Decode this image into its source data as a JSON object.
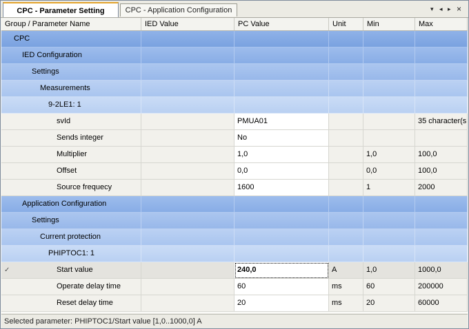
{
  "tabs": [
    {
      "label": "CPC - Parameter Setting",
      "active": true
    },
    {
      "label": "CPC - Application Configuration",
      "active": false
    }
  ],
  "tab_controls": {
    "dropdown": "▾",
    "prev": "◂",
    "next": "▸",
    "close": "×"
  },
  "columns": [
    "Group / Parameter Name",
    "IED Value",
    "PC Value",
    "Unit",
    "Min",
    "Max"
  ],
  "rows": [
    {
      "level": 0,
      "type": "group",
      "name": "CPC"
    },
    {
      "level": 1,
      "type": "group",
      "name": "IED Configuration"
    },
    {
      "level": 2,
      "type": "group",
      "name": "Settings"
    },
    {
      "level": 3,
      "type": "group",
      "name": "Measurements"
    },
    {
      "level": 4,
      "type": "group",
      "name": "9-2LE1: 1"
    },
    {
      "level": 5,
      "type": "param",
      "name": "svId",
      "ied": "",
      "pc": "PMUA01",
      "unit": "",
      "min": "",
      "max": "35 character(s"
    },
    {
      "level": 5,
      "type": "param",
      "name": "Sends integer",
      "ied": "",
      "pc": "No",
      "unit": "",
      "min": "",
      "max": ""
    },
    {
      "level": 5,
      "type": "param",
      "name": "Multiplier",
      "ied": "",
      "pc": "1,0",
      "unit": "",
      "min": "1,0",
      "max": "100,0"
    },
    {
      "level": 5,
      "type": "param",
      "name": "Offset",
      "ied": "",
      "pc": "0,0",
      "unit": "",
      "min": "0,0",
      "max": "100,0"
    },
    {
      "level": 5,
      "type": "param",
      "name": "Source frequecy",
      "ied": "",
      "pc": "1600",
      "unit": "",
      "min": "1",
      "max": "2000"
    },
    {
      "level": 1,
      "type": "group",
      "name": "Application Configuration"
    },
    {
      "level": 2,
      "type": "group",
      "name": "Settings"
    },
    {
      "level": 3,
      "type": "group",
      "name": "Current protection"
    },
    {
      "level": 4,
      "type": "group",
      "name": "PHIPTOC1: 1"
    },
    {
      "level": 5,
      "type": "param",
      "name": "Start value",
      "ied": "",
      "pc": "240,0",
      "unit": "A",
      "min": "1,0",
      "max": "1000,0",
      "selected": true,
      "marker": "✓"
    },
    {
      "level": 5,
      "type": "param",
      "name": "Operate delay time",
      "ied": "",
      "pc": "60",
      "unit": "ms",
      "min": "60",
      "max": "200000"
    },
    {
      "level": 5,
      "type": "param",
      "name": "Reset delay time",
      "ied": "",
      "pc": "20",
      "unit": "ms",
      "min": "20",
      "max": "60000"
    }
  ],
  "status": "Selected parameter: PHIPTOC1/Start value [1,0..1000,0] A"
}
